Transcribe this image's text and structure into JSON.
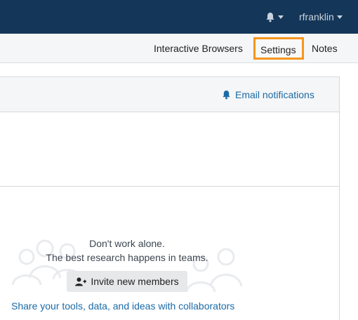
{
  "header": {
    "username": "rfranklin"
  },
  "subnav": {
    "items": [
      {
        "label": "Interactive Browsers"
      },
      {
        "label": "Settings"
      },
      {
        "label": "Notes"
      }
    ]
  },
  "panel": {
    "email_notifications_label": "Email notifications"
  },
  "empty_state": {
    "line1": "Don't work alone.",
    "line2": "The best research happens in teams.",
    "invite_button": "Invite new members",
    "share_link": "Share your tools, data, and ideas with collaborators"
  },
  "colors": {
    "topbar": "#143658",
    "link": "#1b6aa6",
    "highlight": "#f5961d"
  },
  "icons": [
    "bell-icon",
    "caret-down-icon",
    "user-plus-icon",
    "people-illustration"
  ]
}
